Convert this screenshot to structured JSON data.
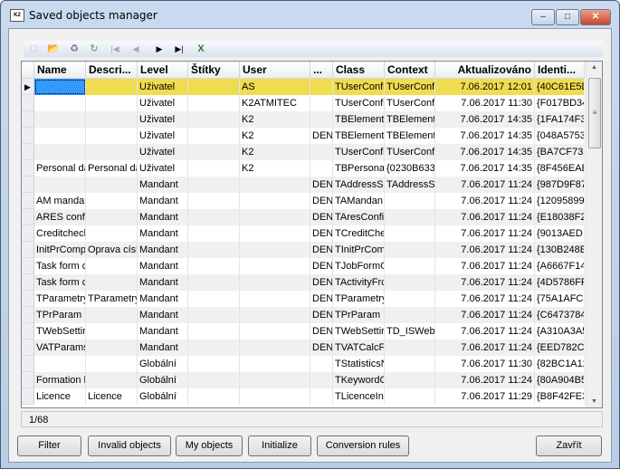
{
  "window": {
    "title": "Saved objects manager",
    "app_icon": "K2",
    "controls": [
      "minimize",
      "maximize",
      "close"
    ]
  },
  "toolbar": [
    "new-icon",
    "open-folder-icon",
    "delete-icon",
    "refresh-icon",
    "first-record-icon",
    "prev-record-icon",
    "next-record-icon",
    "last-record-icon",
    "excel-export-icon"
  ],
  "grid": {
    "columns": [
      "Name",
      "Descri...",
      "Level",
      "Štítky",
      "User",
      "...",
      "Class",
      "Context",
      "Aktualizováno",
      "Identi..."
    ],
    "rows": [
      [
        "",
        "",
        "Uživatel",
        "",
        "AS",
        "",
        "TUserConfi",
        "TUserConfi",
        "7.06.2017 12:01",
        "{40C61E5D"
      ],
      [
        "",
        "",
        "Uživatel",
        "",
        "K2ATMITEC",
        "",
        "TUserConfi",
        "TUserConfi",
        "7.06.2017 11:30",
        "{F017BD34"
      ],
      [
        "",
        "",
        "Uživatel",
        "",
        "K2",
        "",
        "TBElementI",
        "TBElementI",
        "7.06.2017 14:35",
        "{1FA174F3"
      ],
      [
        "",
        "",
        "Uživatel",
        "",
        "K2",
        "DEN",
        "TBElementI",
        "TBElementI",
        "7.06.2017 14:35",
        "{048A5753"
      ],
      [
        "",
        "",
        "Uživatel",
        "",
        "K2",
        "",
        "TUserConfi",
        "TUserConfi",
        "7.06.2017 14:35",
        "{BA7CF73"
      ],
      [
        "Personal da",
        "Personal da",
        "Uživatel",
        "",
        "K2",
        "",
        "TBPersona",
        "{0230B633",
        "7.06.2017 14:35",
        "{8F456EAE"
      ],
      [
        "",
        "",
        "Mandant",
        "",
        "",
        "DEN",
        "TAddressSI",
        "TAddressSI",
        "7.06.2017 11:24",
        "{987D9F87"
      ],
      [
        "AM mandar",
        "",
        "Mandant",
        "",
        "",
        "DEN",
        "TAMandan",
        "",
        "7.06.2017 11:24",
        "{12095899"
      ],
      [
        "ARES conf",
        "",
        "Mandant",
        "",
        "",
        "DEN",
        "TAresConfi",
        "",
        "7.06.2017 11:24",
        "{E18038F2"
      ],
      [
        "Creditcheck",
        "",
        "Mandant",
        "",
        "",
        "DEN",
        "TCreditChe",
        "",
        "7.06.2017 11:24",
        "{9013AED"
      ],
      [
        "InitPrCompl",
        "Oprava císl",
        "Mandant",
        "",
        "",
        "DEN",
        "TInitPrComp",
        "",
        "7.06.2017 11:24",
        "{130B248E"
      ],
      [
        "Task form c",
        "",
        "Mandant",
        "",
        "",
        "DEN",
        "TJobFormC",
        "",
        "7.06.2017 11:24",
        "{A6667F14"
      ],
      [
        "Task form c",
        "",
        "Mandant",
        "",
        "",
        "DEN",
        "TActivityFrc",
        "",
        "7.06.2017 11:24",
        "{4D5786FF"
      ],
      [
        "TParametry",
        "TParametry",
        "Mandant",
        "",
        "",
        "DEN",
        "TParametry",
        "",
        "7.06.2017 11:24",
        "{75A1AFCI"
      ],
      [
        "TPrParam",
        "",
        "Mandant",
        "",
        "",
        "DEN",
        "TPrParam",
        "",
        "7.06.2017 11:24",
        "{C6473784"
      ],
      [
        "TWebSettir",
        "",
        "Mandant",
        "",
        "",
        "DEN",
        "TWebSettir",
        "TD_ISWeb",
        "7.06.2017 11:24",
        "{A310A3A5"
      ],
      [
        "VATParams",
        "",
        "Mandant",
        "",
        "",
        "DEN",
        "TVATCalcF",
        "",
        "7.06.2017 11:24",
        "{EED782C"
      ],
      [
        "",
        "",
        "Globální",
        "",
        "",
        "",
        "TStatisticsN",
        "",
        "7.06.2017 11:30",
        "{82BC1A12"
      ],
      [
        "Formation k",
        "",
        "Globální",
        "",
        "",
        "",
        "TKeywordC",
        "",
        "7.06.2017 11:24",
        "{80A904B5"
      ],
      [
        "Licence",
        "Licence",
        "Globální",
        "",
        "",
        "",
        "TLicenceIn",
        "",
        "7.06.2017 11:29",
        "{B8F42FE3"
      ]
    ],
    "selected_row": 0
  },
  "status": {
    "record": "1/68"
  },
  "buttons": {
    "filter": "Filter",
    "invalid": "Invalid objects",
    "my": "My objects",
    "initialize": "Initialize",
    "conversion": "Conversion rules",
    "close": "Zavřít"
  },
  "colors": {
    "selected_row": "#f0dc50",
    "focus_cell": "#3399ff",
    "alt_row": "#f0f0f0"
  }
}
